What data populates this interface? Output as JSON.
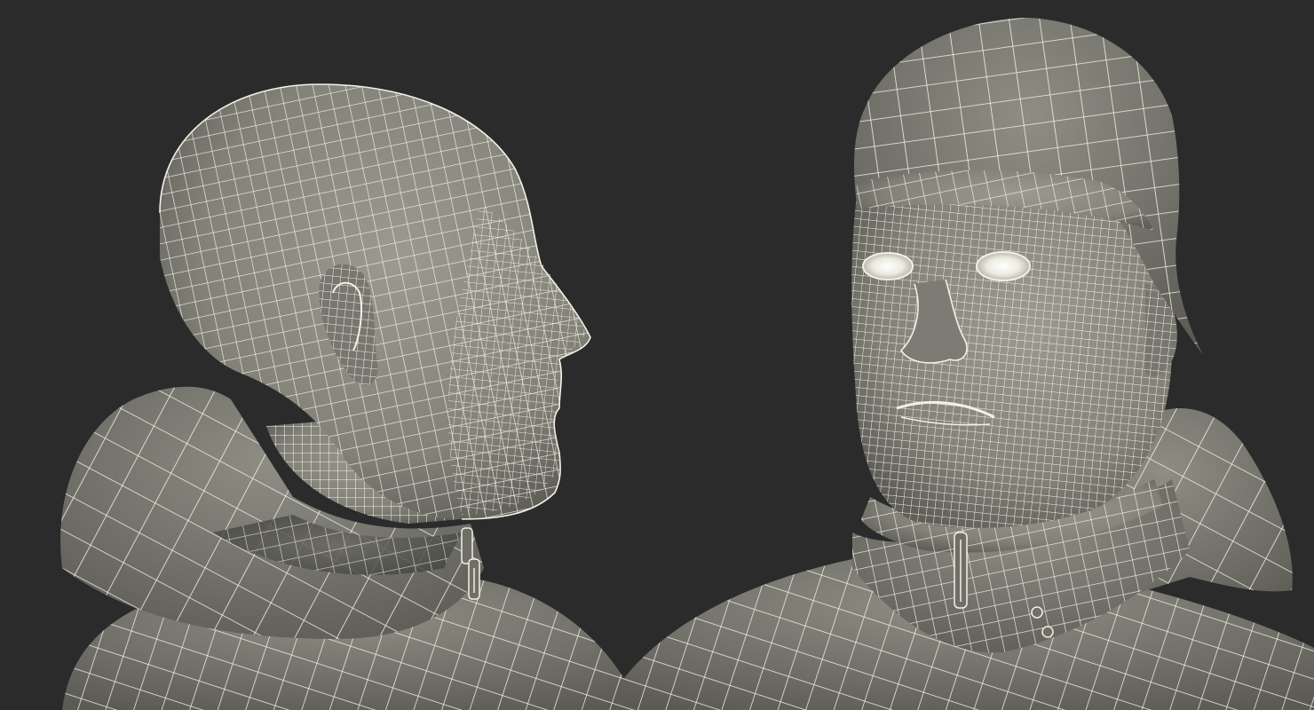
{
  "scene": {
    "background_color": "#2b2b2b",
    "mesh_surface_color": "#8c8c83",
    "mesh_shadow_color": "#5f5f58",
    "wireframe_color": "#f3f1e6",
    "views": [
      {
        "name": "side-profile-view",
        "subject": "head-with-hood"
      },
      {
        "name": "front-three-quarter-view",
        "subject": "head-with-beanie-and-hood"
      }
    ]
  }
}
